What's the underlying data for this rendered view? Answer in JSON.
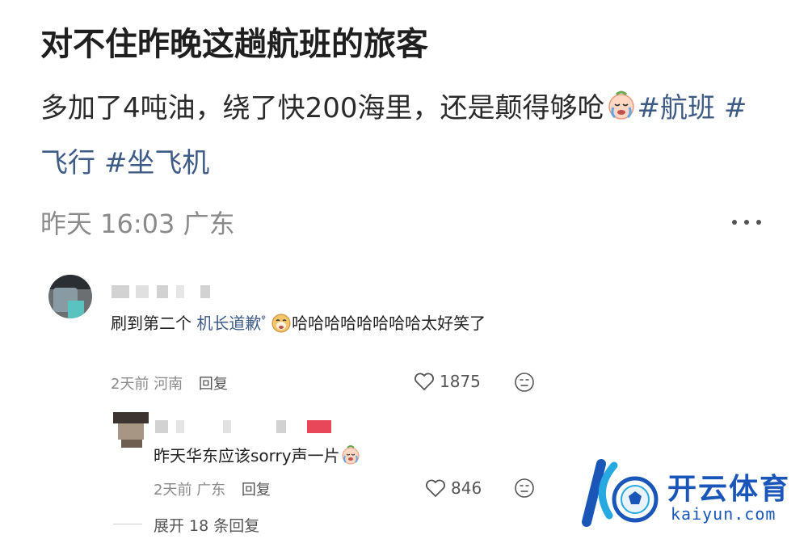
{
  "post": {
    "title": "对不住昨晚这趟航班的旅客",
    "body_text": "多加了4吨油，绕了快200海里，还是颠得够呛",
    "tags": [
      "#航班",
      "#飞行",
      "#坐飞机"
    ],
    "time": "昨天 16:03",
    "location": "广东",
    "emoji_icon": "crying-face-icon",
    "more_icon": "more-dots-icon"
  },
  "comments": [
    {
      "text_prefix": "刷到第二个",
      "link_text": "机长道歉",
      "search_mark": "ᵠ",
      "text_suffix": "哈哈哈哈哈哈哈哈太好笑了",
      "emoji_icon": "laughing-dog-icon",
      "time": "2天前",
      "location": "河南",
      "reply_label": "回复",
      "likes": "1875"
    },
    {
      "text": "昨天华东应该sorry声一片",
      "emoji_icon": "crying-face-icon",
      "time": "2天前",
      "location": "广东",
      "reply_label": "回复",
      "likes": "846"
    }
  ],
  "expand_replies": "展开 18 条回复",
  "watermark": {
    "brand_cn": "开云体育",
    "brand_en": "kaiyun.com"
  },
  "colors": {
    "tag": "#3e5a86",
    "meta": "#8a8a8a",
    "watermark": "#1a56b8"
  }
}
